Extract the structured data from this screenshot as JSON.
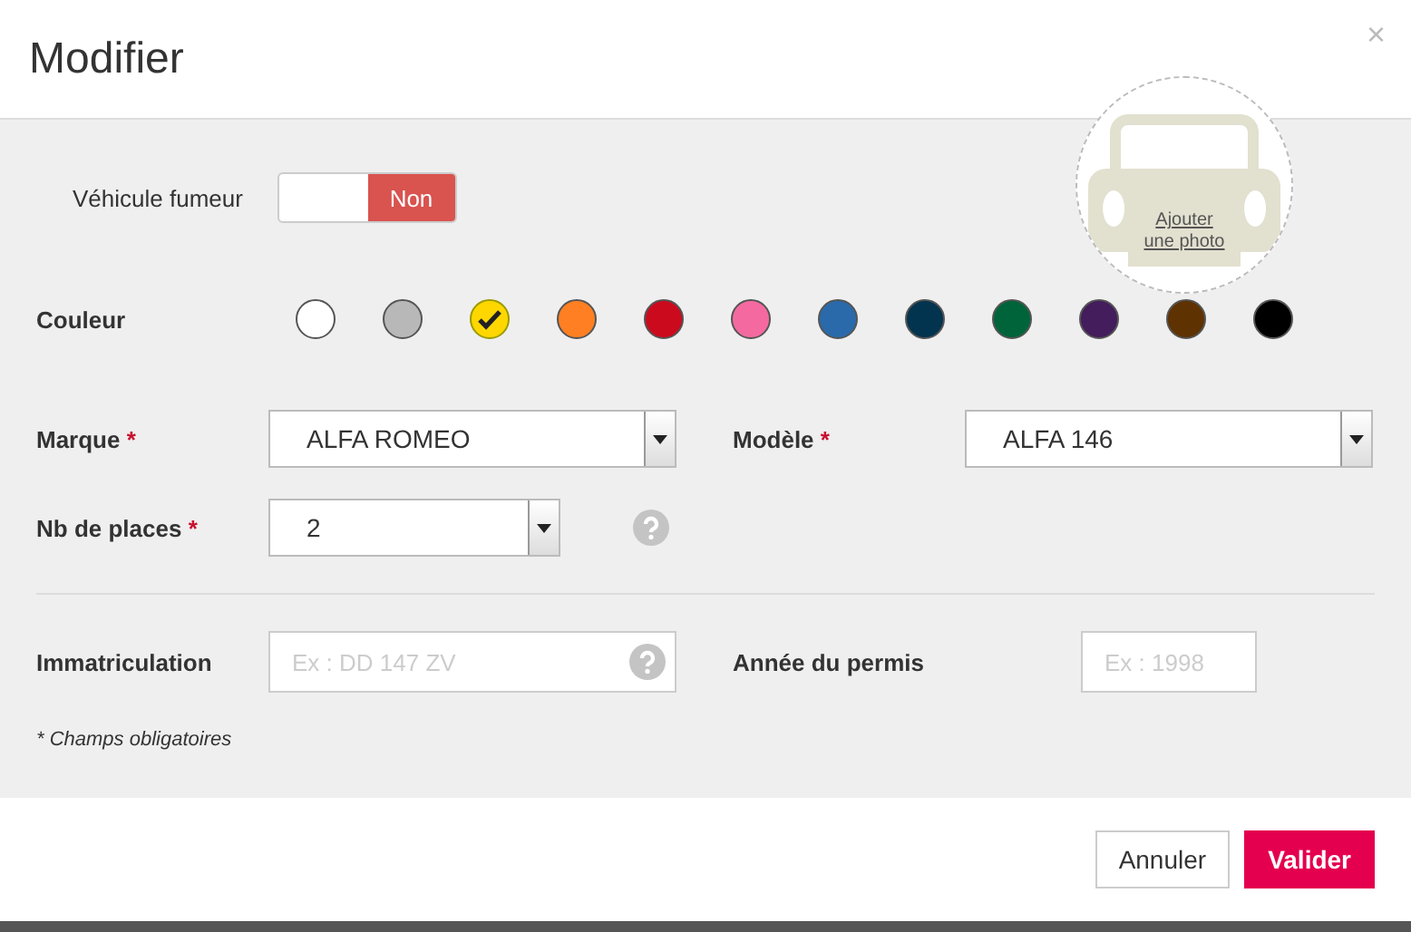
{
  "window": {
    "title": "Modifier",
    "close": "×"
  },
  "smoker": {
    "label": "Véhicule fumeur",
    "on": false,
    "value": "Non"
  },
  "photo": {
    "label": "Ajouter une photo"
  },
  "colors": {
    "label": "Couleur",
    "items": [
      {
        "color": "#ffffff",
        "selected": false
      },
      {
        "color": "#b8b8b8",
        "selected": false
      },
      {
        "color": "#ffd700",
        "selected": true
      },
      {
        "color": "#ff7f22",
        "selected": false
      },
      {
        "color": "#cc0a1e",
        "selected": false
      },
      {
        "color": "#f46aa0",
        "selected": false
      },
      {
        "color": "#2a6aab",
        "selected": false
      },
      {
        "color": "#03344f",
        "selected": false
      },
      {
        "color": "#00643b",
        "selected": false
      },
      {
        "color": "#441d5c",
        "selected": false
      },
      {
        "color": "#5f3201",
        "selected": false
      },
      {
        "color": "#000000",
        "selected": false
      }
    ]
  },
  "brand": {
    "label": "Marque",
    "marker": "*",
    "value": "ALFA ROMEO"
  },
  "model": {
    "label": "Modèle",
    "marker": "*",
    "value": "ALFA 146"
  },
  "seats": {
    "label": "Nb de places",
    "marker": "*",
    "value": "2"
  },
  "plate": {
    "label": "Immatriculation",
    "placeholder": "Ex : DD 147 ZV"
  },
  "license_year": {
    "label": "Année du permis",
    "placeholder": "Ex : 1998"
  },
  "required_note": "* Champs obligatoires",
  "buttons": [
    {
      "label": "Annuler",
      "kind": "secondary"
    },
    {
      "label": "Valider",
      "kind": "primary"
    }
  ]
}
